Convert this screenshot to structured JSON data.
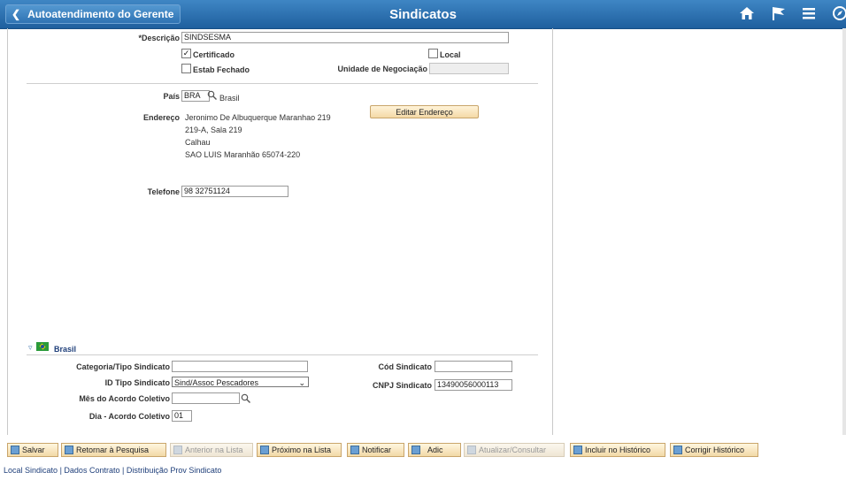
{
  "header": {
    "back_label": "Autoatendimento do Gerente",
    "title": "Sindicatos"
  },
  "form": {
    "descricao_label": "*Descrição",
    "descricao_value": "SINDSESMA",
    "certificado_label": "Certificado",
    "certificado_checked": true,
    "local_label": "Local",
    "local_checked": false,
    "estab_fechado_label": "Estab Fechado",
    "estab_fechado_checked": false,
    "unidade_label": "Unidade de Negociação",
    "unidade_value": "",
    "pais_label": "País",
    "pais_value": "BRA",
    "pais_name": "Brasil",
    "endereco_label": "Endereço",
    "endereco_lines": [
      "Jeronimo De Albuquerque Maranhao 219",
      "219-A, Sala 219",
      "Calhau",
      "SAO LUIS Maranhão 65074-220"
    ],
    "editar_endereco_label": "Editar Endereço",
    "telefone_label": "Telefone",
    "telefone_value": "98 32751124"
  },
  "brasil_section": {
    "title": "Brasil",
    "categoria_label": "Categoria/Tipo Sindicato",
    "categoria_value": "",
    "id_tipo_label": "ID Tipo Sindicato",
    "id_tipo_value": "Sind/Assoc Pescadores",
    "mes_acordo_label": "Mês do Acordo Coletivo",
    "mes_acordo_value": "",
    "dia_acordo_label": "Dia - Acordo Coletivo",
    "dia_acordo_value": "01",
    "cod_sindicato_label": "Cód Sindicato",
    "cod_sindicato_value": "",
    "cnpj_label": "CNPJ Sindicato",
    "cnpj_value": "13490056000113"
  },
  "toolbar": {
    "salvar": "Salvar",
    "retornar": "Retornar à Pesquisa",
    "anterior": "Anterior na Lista",
    "proximo": "Próximo na Lista",
    "notificar": "Notificar",
    "adic": "Adic",
    "atualizar": "Atualizar/Consultar",
    "incluir": "Incluir no Histórico",
    "corrigir": "Corrigir Histórico"
  },
  "links": {
    "local": "Local Sindicato",
    "dados": "Dados Contrato",
    "distribuicao": "Distribuição Prov Sindicato",
    "separator": "|"
  },
  "colors": {
    "header_bg": "#2f73b3",
    "button_bg": "#f4d9a6",
    "link": "#1f3f7a"
  }
}
